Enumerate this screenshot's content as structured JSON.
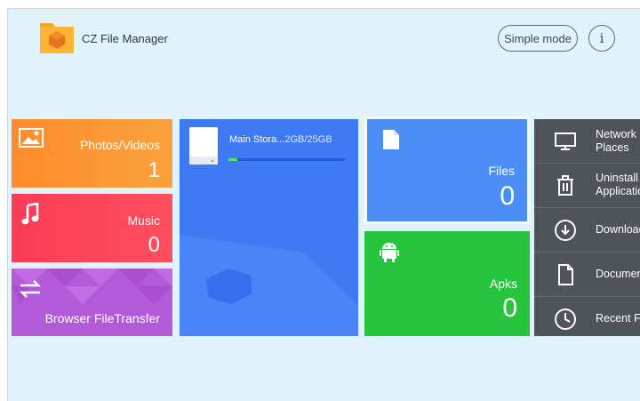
{
  "app": {
    "title": "CZ File Manager"
  },
  "header": {
    "simple_mode_label": "Simple mode",
    "info_label": "i"
  },
  "tiles": {
    "photos": {
      "label": "Photos/Videos",
      "count": "1"
    },
    "music": {
      "label": "Music",
      "count": "0"
    },
    "transfer": {
      "label": "Browser FileTransfer"
    },
    "storage": {
      "label": "Main Stora...",
      "size": "2GB/25GB",
      "used_fraction": 0.08
    },
    "files": {
      "label": "Files",
      "count": "0"
    },
    "apks": {
      "label": "Apks",
      "count": "0"
    }
  },
  "right_panel": [
    {
      "label_line1": "Network",
      "label_line2": "Places",
      "icon": "monitor-icon"
    },
    {
      "label_line1": "Uninstall",
      "label_line2": "Applications",
      "icon": "trash-icon"
    },
    {
      "label_line1": "Downloads",
      "label_line2": "",
      "icon": "download-icon"
    },
    {
      "label_line1": "Documents",
      "label_line2": "",
      "icon": "document-icon"
    },
    {
      "label_line1": "Recent Files",
      "label_line2": "",
      "icon": "clock-icon"
    }
  ],
  "colors": {
    "background": "#e0f3fa",
    "photos": "#ff8b2c",
    "music": "#fa3c56",
    "transfer": "#b35ad9",
    "storage": "#3f7af5",
    "files": "#4a8ef6",
    "apks": "#27c43d",
    "right_panel": "#4e5459"
  }
}
